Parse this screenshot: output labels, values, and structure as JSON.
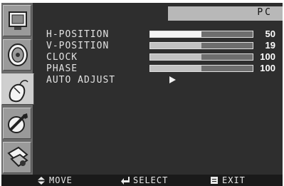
{
  "header": {
    "title": "PC"
  },
  "sidebar": {
    "items": [
      {
        "icon": "monitor-icon",
        "selected": false
      },
      {
        "icon": "speaker-icon",
        "selected": false
      },
      {
        "icon": "mouse-icon",
        "selected": true
      },
      {
        "icon": "tools-icon",
        "selected": false
      },
      {
        "icon": "settings-icon",
        "selected": false
      }
    ]
  },
  "menu": {
    "rows": [
      {
        "label": "H-POSITION",
        "value": "50",
        "fill_fraction": 0.5
      },
      {
        "label": "V-POSITION",
        "value": "19",
        "fill_fraction": 0.5
      },
      {
        "label": "CLOCK",
        "value": "100",
        "fill_fraction": 0.5
      },
      {
        "label": "PHASE",
        "value": "100",
        "fill_fraction": 0.5
      }
    ],
    "auto_adjust": {
      "label": "AUTO ADJUST",
      "icon": "play-arrow-icon"
    }
  },
  "footer": {
    "move": {
      "label": "MOVE",
      "icon": "up-down-arrows-icon"
    },
    "select": {
      "label": "SELECT",
      "icon": "enter-icon"
    },
    "exit": {
      "label": "EXIT",
      "icon": "menu-box-icon"
    }
  }
}
